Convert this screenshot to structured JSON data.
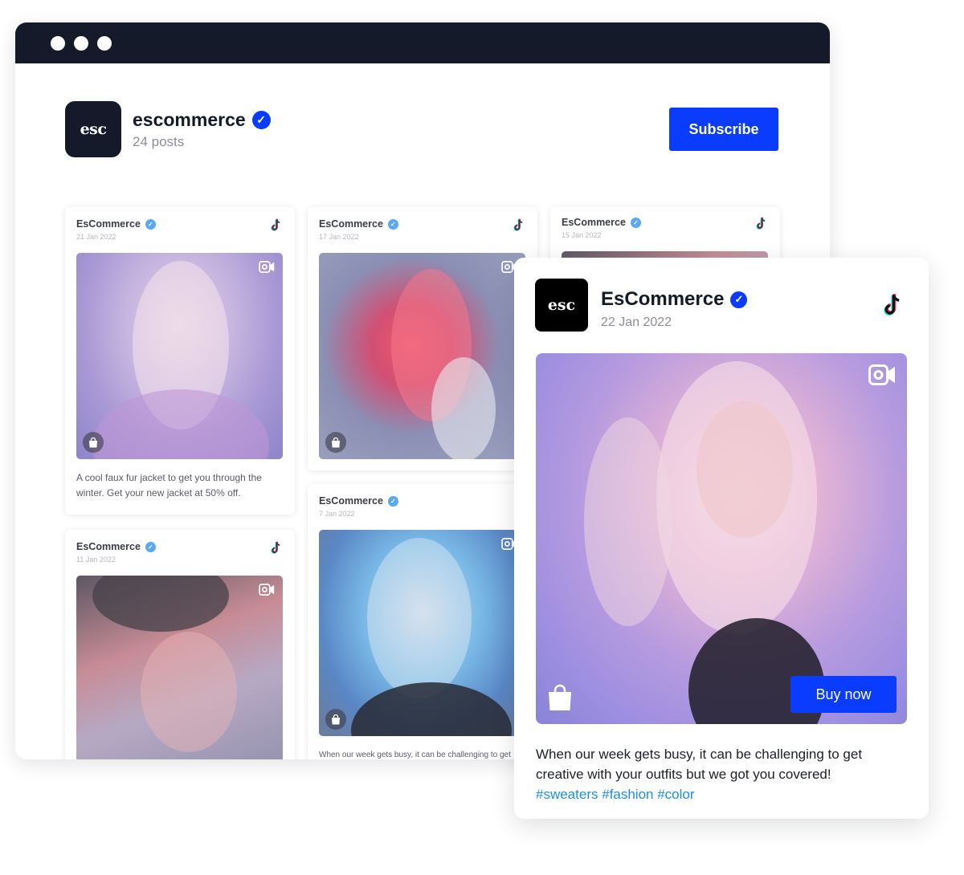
{
  "browser": {
    "dots": 3
  },
  "profile": {
    "logo_text": "esc",
    "name": "escommerce",
    "posts_count": "24 posts",
    "subscribe_label": "Subscribe"
  },
  "feed": {
    "cards": [
      {
        "author": "EsCommerce",
        "date": "21 Jan 2022",
        "caption_line1": "A cool faux fur jacket to get you through the",
        "caption_line2": "winter. Get your new jacket at 50% off."
      },
      {
        "author": "EsCommerce",
        "date": "17 Jan 2022"
      },
      {
        "author": "EsCommerce",
        "date": "15 Jan 2022"
      },
      {
        "author": "EsCommerce",
        "date": "11 Jan 2022"
      },
      {
        "author": "EsCommerce",
        "date": "7 Jan 2022",
        "caption_line1": "When our week gets busy, it can be challenging to get"
      }
    ]
  },
  "post": {
    "logo_text": "esc",
    "author": "EsCommerce",
    "date": "22 Jan 2022",
    "buy_label": "Buy now",
    "caption_line1": "When our week gets busy, it can be challenging to get",
    "caption_line2": "creative with your outfits but we got you covered!",
    "hashtags": "#sweaters #fashion #color"
  },
  "colors": {
    "accent": "#0a3cff",
    "titlebar": "#141a2a",
    "hashtag": "#1a8ef0"
  },
  "icons": [
    "checkmark-icon",
    "tiktok-icon",
    "camera-icon",
    "shopping-bag-icon"
  ]
}
